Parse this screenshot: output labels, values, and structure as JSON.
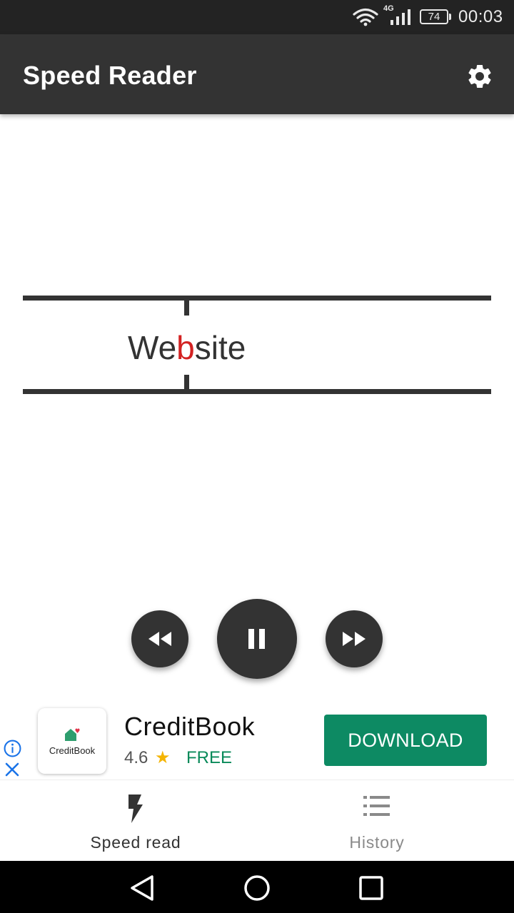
{
  "status_bar": {
    "network_type": "4G",
    "battery_level": "74",
    "time": "00:03"
  },
  "app_bar": {
    "title": "Speed Reader",
    "settings_icon": "gear-icon"
  },
  "reader": {
    "word_before_focus": "We",
    "focus_letter": "b",
    "word_after_focus": "site",
    "focus_color": "#d32222"
  },
  "controls": {
    "rewind_icon": "rewind-icon",
    "pause_icon": "pause-icon",
    "forward_icon": "fast-forward-icon"
  },
  "ad": {
    "app_name": "CreditBook",
    "icon_text": "CreditBook",
    "rating": "4.6",
    "star": "★",
    "price": "FREE",
    "cta": "DOWNLOAD",
    "accent_color": "#0d8a63"
  },
  "bottom_nav": {
    "items": [
      {
        "label": "Speed read",
        "icon": "lightning-icon",
        "active": true
      },
      {
        "label": "History",
        "icon": "list-icon",
        "active": false
      }
    ]
  },
  "colors": {
    "app_bar": "#333333",
    "status_bar": "#232323"
  }
}
